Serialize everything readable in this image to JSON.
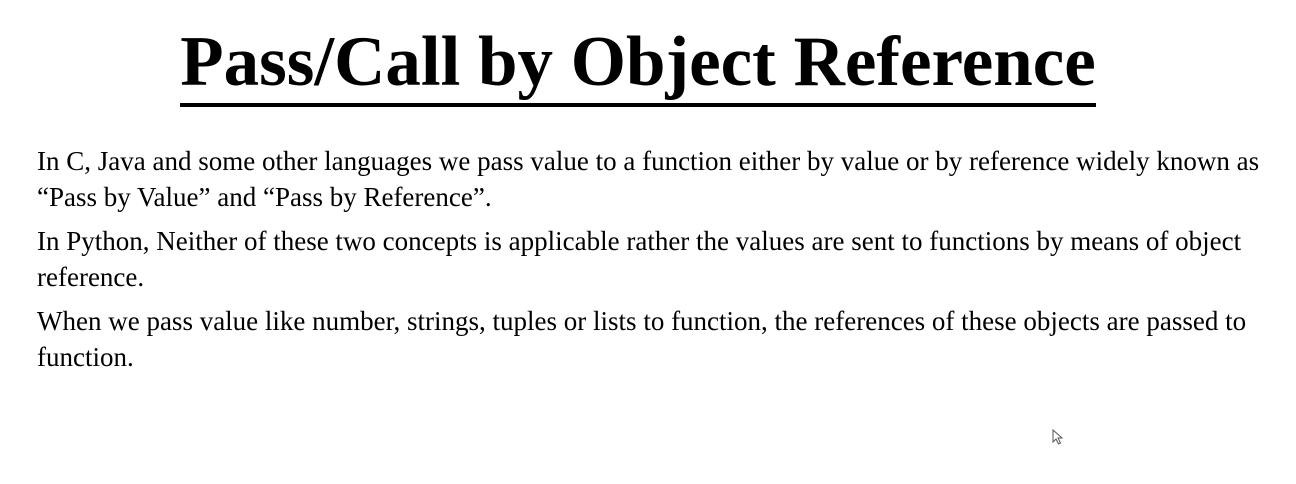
{
  "slide": {
    "title": "Pass/Call by Object Reference",
    "paragraphs": [
      "In C, Java and some other languages we pass value to a function either by value or by reference widely known as “Pass by Value” and “Pass by Reference”.",
      "In Python, Neither of these two concepts is applicable rather the values are sent to functions by means of object reference.",
      "When we pass value like number, strings, tuples or lists to function, the references of these objects are passed to function."
    ]
  },
  "icons": {
    "cursor": "mouse-pointer-icon"
  }
}
